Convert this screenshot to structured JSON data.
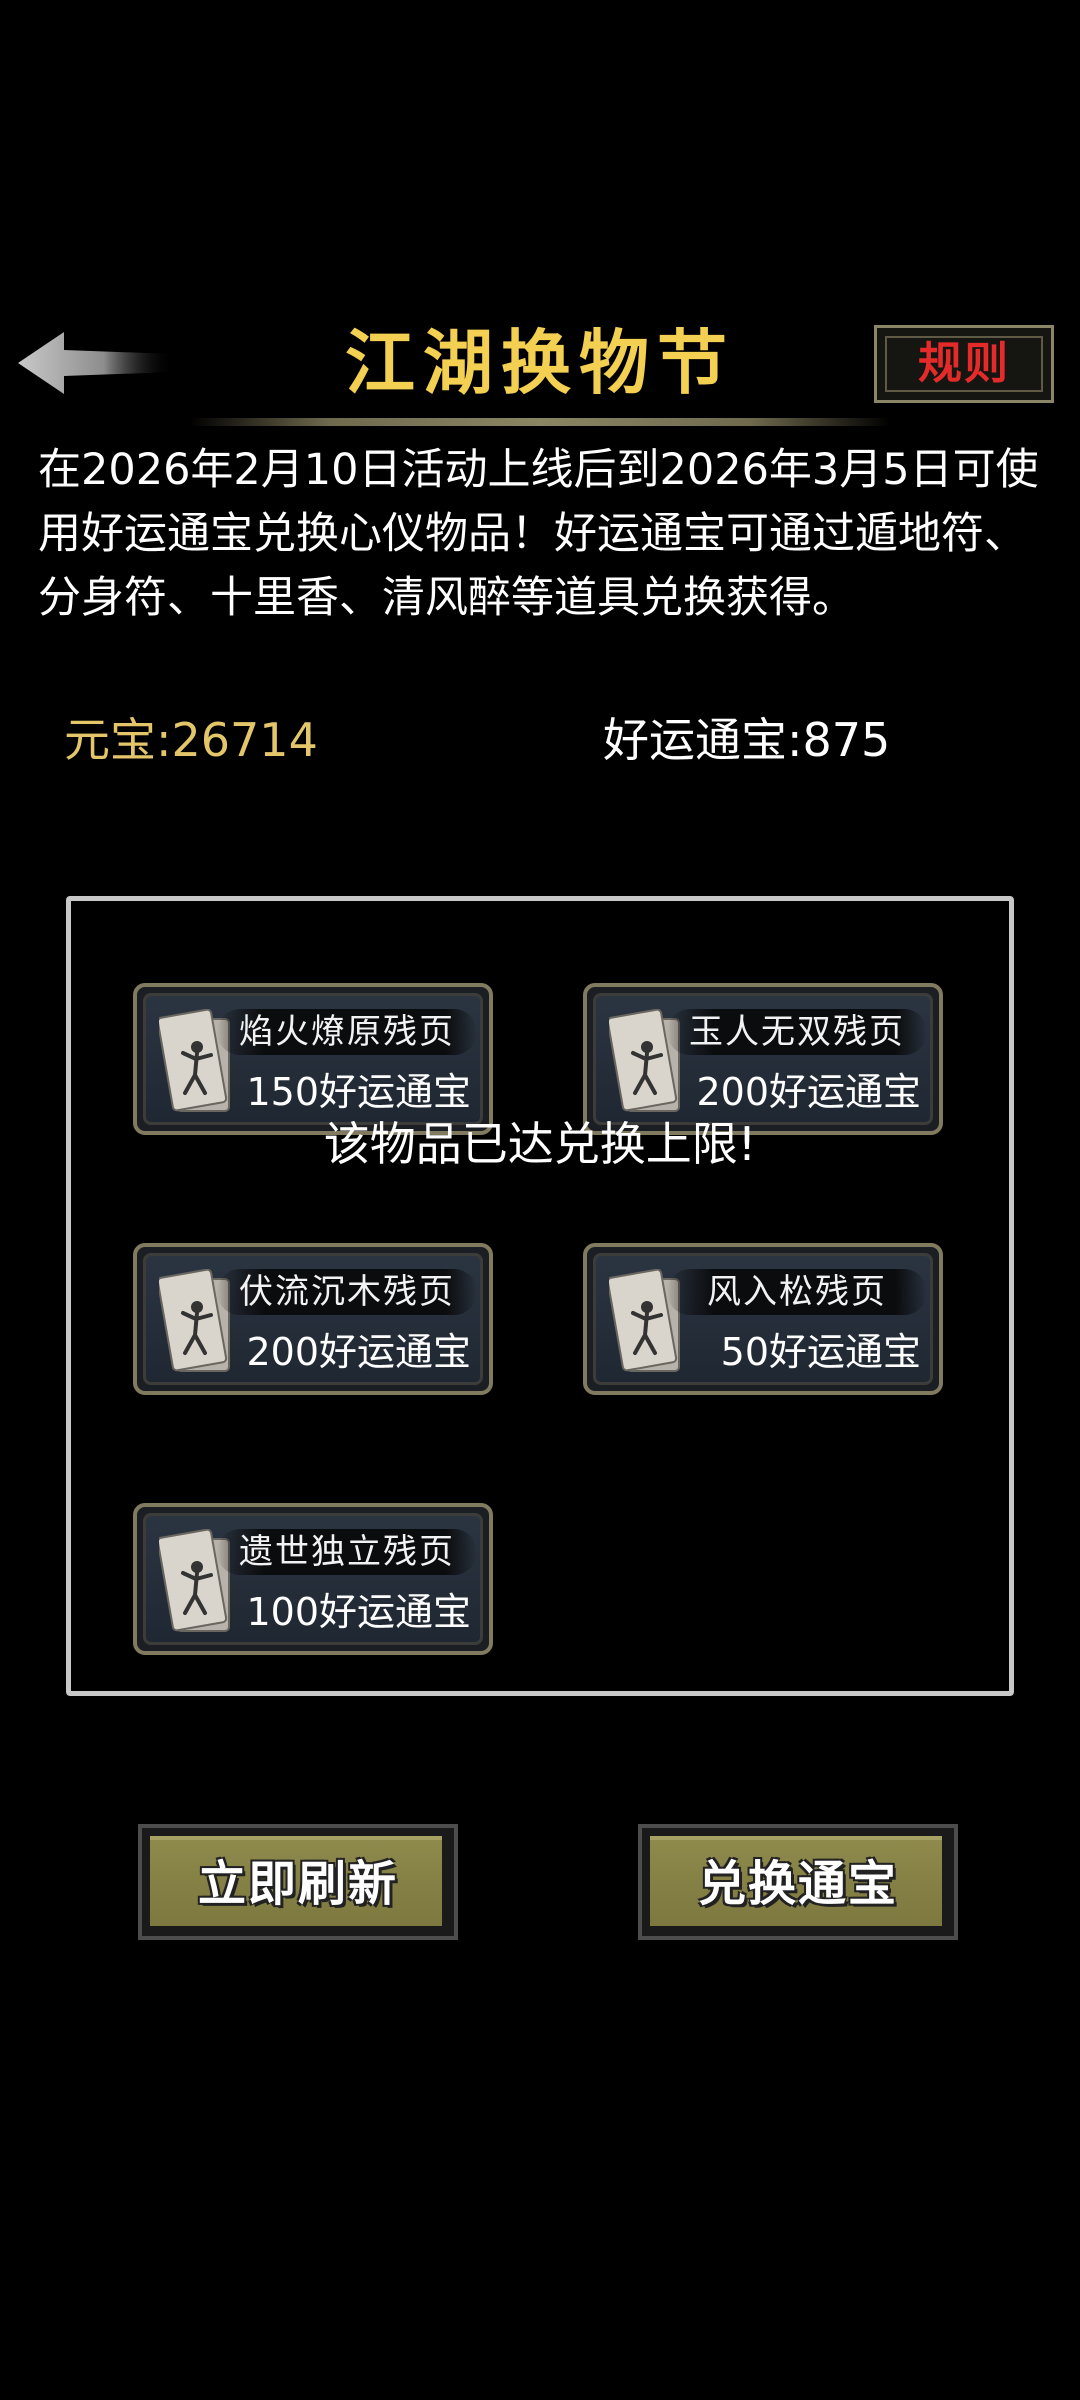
{
  "header": {
    "title": "江湖换物节",
    "rules_label": "规则",
    "back_icon": "back-arrow-icon"
  },
  "description": "在2026年2月10日活动上线后到2026年3月5日可使用好运通宝兑换心仪物品！好运通宝可通过遁地符、分身符、十里香、清风醉等道具兑换获得。",
  "currency": {
    "yuanbao": "元宝:26714",
    "fortune": "好运通宝:875"
  },
  "items": [
    {
      "name": "焰火燎原残页",
      "price": "150好运通宝",
      "icon": "martial-scroll-icon"
    },
    {
      "name": "玉人无双残页",
      "price": "200好运通宝",
      "icon": "martial-scroll-icon"
    },
    {
      "name": "伏流沉木残页",
      "price": "200好运通宝",
      "icon": "martial-scroll-icon"
    },
    {
      "name": "风入松残页",
      "price": "50好运通宝",
      "icon": "martial-scroll-icon"
    },
    {
      "name": "遗世独立残页",
      "price": "100好运通宝",
      "icon": "martial-scroll-icon"
    }
  ],
  "toast": "该物品已达兑换上限!",
  "actions": {
    "refresh_label": "立即刷新",
    "exchange_label": "兑换通宝"
  },
  "colors": {
    "title": "#f3cf52",
    "yuanbao": "#e3c56a",
    "rules": "#e52a2a",
    "button_face": "#8e8a4c"
  }
}
